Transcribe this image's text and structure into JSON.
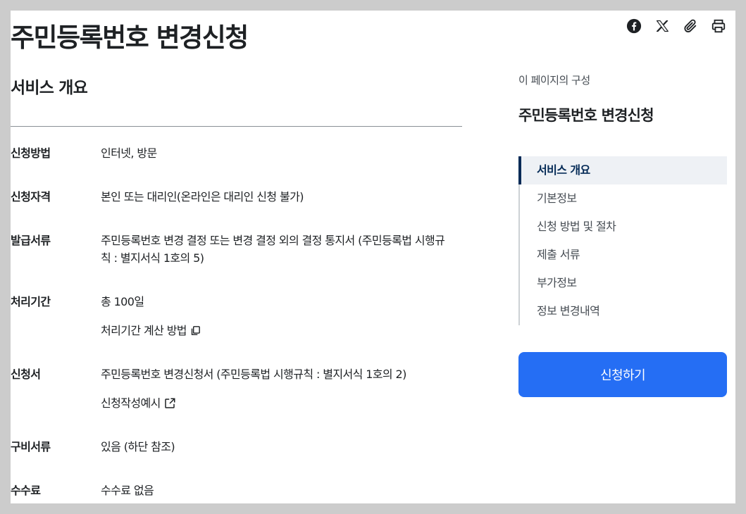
{
  "page": {
    "title": "주민등록번호 변경신청",
    "section_title": "서비스 개요"
  },
  "share": {
    "icons": [
      "facebook-icon",
      "x-icon",
      "paperclip-icon",
      "printer-icon"
    ]
  },
  "rows": [
    {
      "label": "신청방법",
      "value": "인터넷, 방문"
    },
    {
      "label": "신청자격",
      "value": "본인 또는 대리인(온라인은 대리인 신청 불가)"
    },
    {
      "label": "발급서류",
      "value": "주민등록번호 변경 결정 또는 변경 결정 외의 결정 통지서 (주민등록법 시행규",
      "value2": "칙 : 별지서식 1호의 5)"
    },
    {
      "label": "처리기간",
      "value": "총 100일",
      "link": "처리기간 계산 방법"
    },
    {
      "label": "신청서",
      "value": "주민등록번호 변경신청서 (주민등록법 시행규칙 : 별지서식 1호의 2)",
      "link": "신청작성예시"
    },
    {
      "label": "구비서류",
      "value": "있음 (하단 참조)"
    },
    {
      "label": "수수료",
      "value": "수수료 없음"
    }
  ],
  "toc": {
    "caption": "이 페이지의 구성",
    "title": "주민등록번호 변경신청",
    "items": [
      "서비스 개요",
      "기본정보",
      "신청 방법 및 절차",
      "제출 서류",
      "부가정보",
      "정보 변경내역"
    ],
    "active_index": 0
  },
  "apply_button": "신청하기",
  "colors": {
    "accent": "#256ef4",
    "active_nav": "#052b57",
    "background": "#cccccc"
  }
}
